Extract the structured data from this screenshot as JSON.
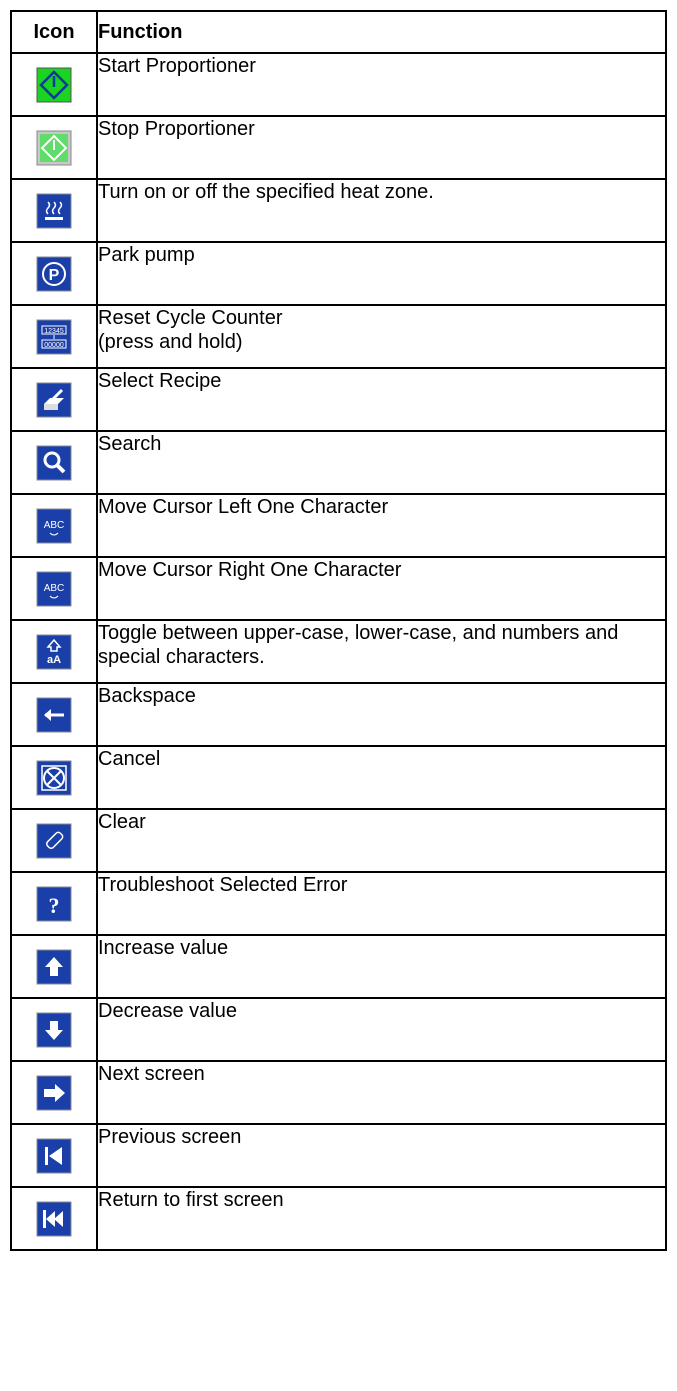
{
  "header": {
    "icon": "Icon",
    "function": "Function"
  },
  "rows": [
    {
      "icon": "start-proportioner-icon",
      "function": "Start Proportioner"
    },
    {
      "icon": "stop-proportioner-icon",
      "function": "Stop Proportioner"
    },
    {
      "icon": "heat-zone-icon",
      "function": "Turn on or off the specified heat zone."
    },
    {
      "icon": "park-pump-icon",
      "function": "Park pump"
    },
    {
      "icon": "reset-cycle-counter-icon",
      "function": "Reset Cycle Counter\n(press and hold)"
    },
    {
      "icon": "select-recipe-icon",
      "function": "Select Recipe"
    },
    {
      "icon": "search-icon",
      "function": "Search"
    },
    {
      "icon": "cursor-left-icon",
      "function": "Move Cursor Left One Character"
    },
    {
      "icon": "cursor-right-icon",
      "function": "Move Cursor Right One Character"
    },
    {
      "icon": "toggle-case-icon",
      "function": "Toggle between upper-case, lower-case, and numbers and special characters."
    },
    {
      "icon": "backspace-icon",
      "function": "Backspace"
    },
    {
      "icon": "cancel-icon",
      "function": "Cancel"
    },
    {
      "icon": "clear-icon",
      "function": "Clear"
    },
    {
      "icon": "troubleshoot-icon",
      "function": "Troubleshoot Selected Error"
    },
    {
      "icon": "increase-icon",
      "function": "Increase value"
    },
    {
      "icon": "decrease-icon",
      "function": "Decrease value"
    },
    {
      "icon": "next-screen-icon",
      "function": "Next screen"
    },
    {
      "icon": "previous-screen-icon",
      "function": "Previous screen"
    },
    {
      "icon": "first-screen-icon",
      "function": "Return to first screen"
    }
  ],
  "colors": {
    "icon_blue": "#1a3fa8",
    "start_green": "#1bd321",
    "stop_green": "#5fdc6a"
  },
  "icon_text": {
    "counter_top": "12345",
    "counter_bottom": "00000",
    "abc": "ABC",
    "case": "aA"
  }
}
